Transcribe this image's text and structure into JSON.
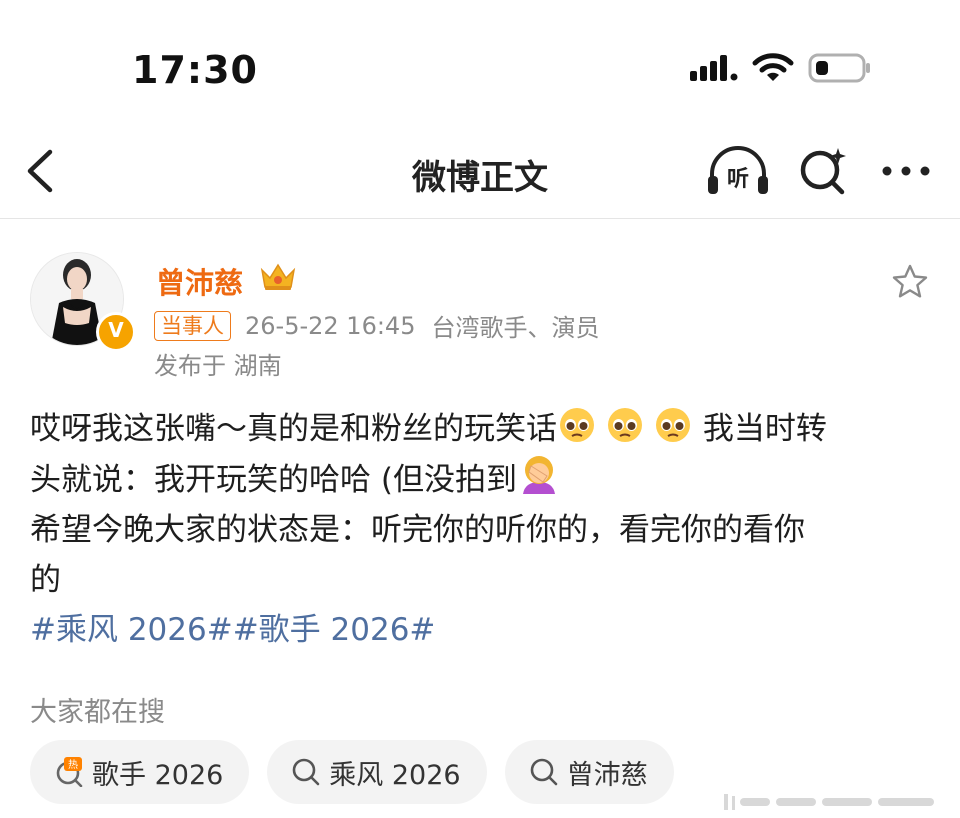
{
  "status_bar": {
    "time": "17:30"
  },
  "nav": {
    "title": "微博正文",
    "listen_label": "听"
  },
  "author": {
    "name": "曾沛慈",
    "verified_mark": "V",
    "tag": "当事人",
    "time": "26-5-22 16:45",
    "description": "台湾歌手、演员",
    "location": "发布于 湖南"
  },
  "post": {
    "line1_text": "哎呀我这张嘴～真的是和粉丝的玩笑话",
    "line1_tail": " 我当时转",
    "line2_text": "头就说：我开玩笑的哈哈 (但没拍到",
    "line3_text": "希望今晚大家的状态是：听完你的听你的，看完你的看你",
    "line4_text": "的",
    "hashtags": "#乘风 2026##歌手 2026#",
    "emoji_names": [
      "pleading-face-emoji",
      "pleading-face-emoji",
      "pleading-face-emoji",
      "facepalm-emoji"
    ]
  },
  "hot_search": {
    "title": "大家都在搜",
    "chips": [
      {
        "label": "歌手 2026",
        "icon": "hot-icon"
      },
      {
        "label": "乘风 2026",
        "icon": "search-icon"
      },
      {
        "label": "曾沛慈",
        "icon": "search-icon"
      }
    ]
  },
  "colors": {
    "author_name": "#ee6a12",
    "hashtag": "#4f6fa0",
    "muted": "#8a8a8a",
    "verified": "#f6a300"
  }
}
